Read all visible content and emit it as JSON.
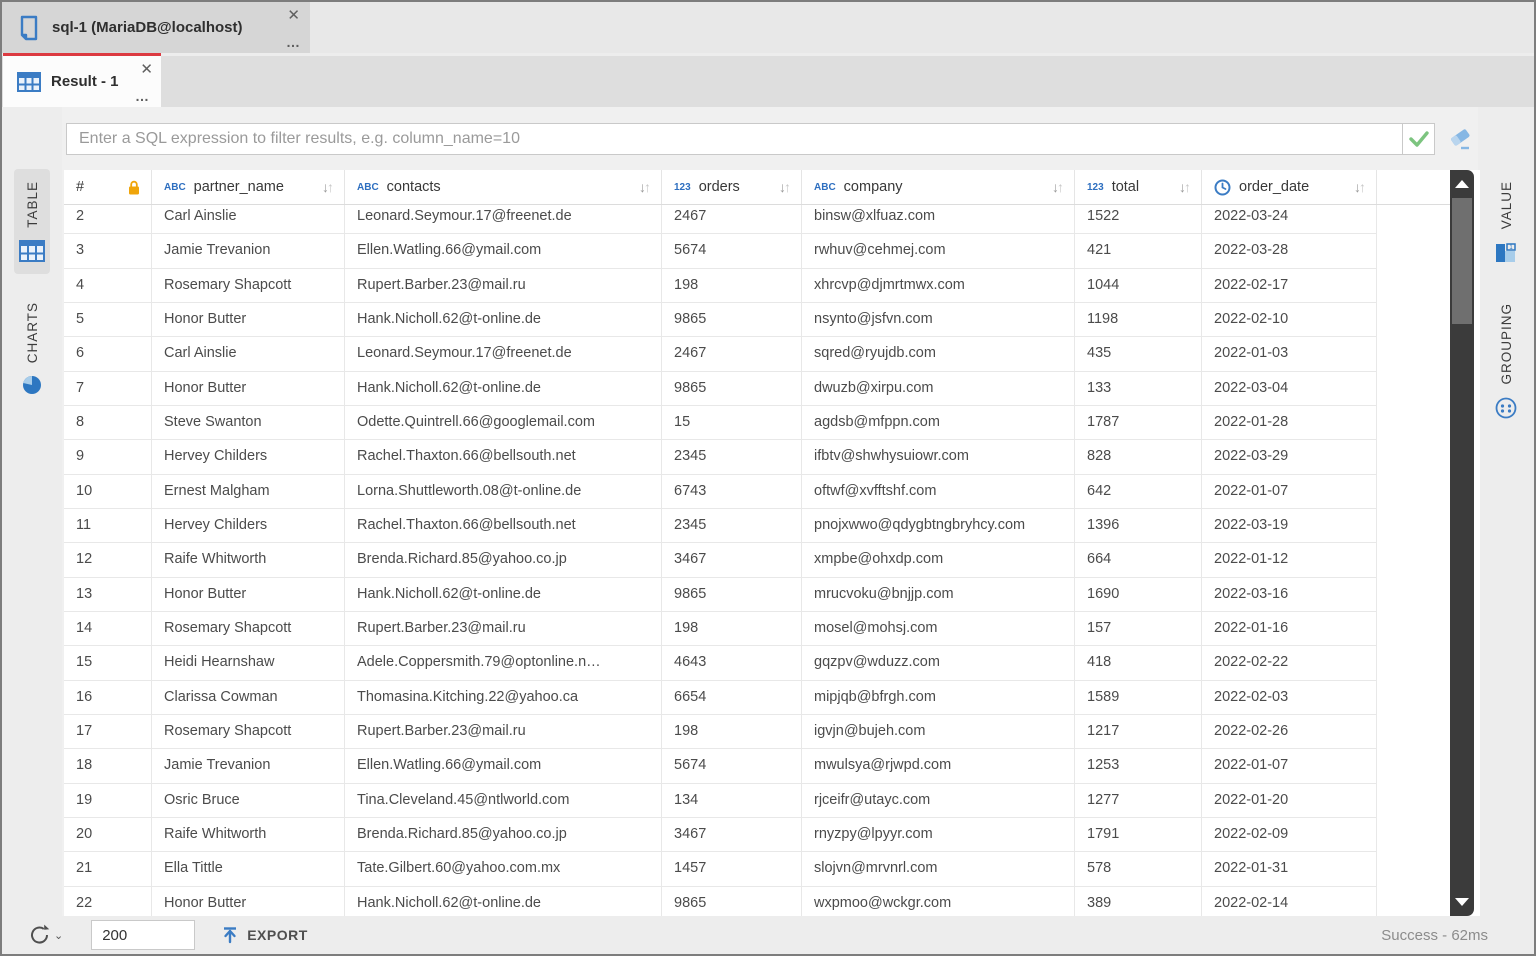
{
  "editor_tab": {
    "title": "sql-1 (MariaDB@localhost)",
    "close": "✕",
    "menu": "…"
  },
  "result_tab": {
    "title": "Result - 1",
    "close": "✕",
    "menu": "…"
  },
  "filter": {
    "placeholder": "Enter a SQL expression to filter results, e.g. column_name=10"
  },
  "left_rail": {
    "tabs": [
      {
        "label": "TABLE"
      },
      {
        "label": "CHARTS"
      }
    ]
  },
  "right_rail": {
    "tabs": [
      {
        "label": "VALUE"
      },
      {
        "label": "GROUPING"
      }
    ]
  },
  "table": {
    "row_number_header": "#",
    "columns": [
      {
        "label": "partner_name",
        "type_label": "ABC"
      },
      {
        "label": "contacts",
        "type_label": "ABC"
      },
      {
        "label": "orders",
        "type_label": "123"
      },
      {
        "label": "company",
        "type_label": "ABC"
      },
      {
        "label": "total",
        "type_label": "123"
      },
      {
        "label": "order_date",
        "type_label": ""
      }
    ],
    "rows": [
      [
        "2",
        "Carl Ainslie",
        "Leonard.Seymour.17@freenet.de",
        "2467",
        "binsw@xlfuaz.com",
        "1522",
        "2022-03-24"
      ],
      [
        "3",
        "Jamie Trevanion",
        "Ellen.Watling.66@ymail.com",
        "5674",
        "rwhuv@cehmej.com",
        "421",
        "2022-03-28"
      ],
      [
        "4",
        "Rosemary Shapcott",
        "Rupert.Barber.23@mail.ru",
        "198",
        "xhrcvp@djmrtmwx.com",
        "1044",
        "2022-02-17"
      ],
      [
        "5",
        "Honor Butter",
        "Hank.Nicholl.62@t-online.de",
        "9865",
        "nsynto@jsfvn.com",
        "1198",
        "2022-02-10"
      ],
      [
        "6",
        "Carl Ainslie",
        "Leonard.Seymour.17@freenet.de",
        "2467",
        "sqred@ryujdb.com",
        "435",
        "2022-01-03"
      ],
      [
        "7",
        "Honor Butter",
        "Hank.Nicholl.62@t-online.de",
        "9865",
        "dwuzb@xirpu.com",
        "133",
        "2022-03-04"
      ],
      [
        "8",
        "Steve Swanton",
        "Odette.Quintrell.66@googlemail.com",
        "15",
        "agdsb@mfppn.com",
        "1787",
        "2022-01-28"
      ],
      [
        "9",
        "Hervey Childers",
        "Rachel.Thaxton.66@bellsouth.net",
        "2345",
        "ifbtv@shwhysuiowr.com",
        "828",
        "2022-03-29"
      ],
      [
        "10",
        "Ernest Malgham",
        "Lorna.Shuttleworth.08@t-online.de",
        "6743",
        "oftwf@xvfftshf.com",
        "642",
        "2022-01-07"
      ],
      [
        "11",
        "Hervey Childers",
        "Rachel.Thaxton.66@bellsouth.net",
        "2345",
        "pnojxwwo@qdygbtngbryhcy.com",
        "1396",
        "2022-03-19"
      ],
      [
        "12",
        "Raife Whitworth",
        "Brenda.Richard.85@yahoo.co.jp",
        "3467",
        "xmpbe@ohxdp.com",
        "664",
        "2022-01-12"
      ],
      [
        "13",
        "Honor Butter",
        "Hank.Nicholl.62@t-online.de",
        "9865",
        "mrucvoku@bnjjp.com",
        "1690",
        "2022-03-16"
      ],
      [
        "14",
        "Rosemary Shapcott",
        "Rupert.Barber.23@mail.ru",
        "198",
        "mosel@mohsj.com",
        "157",
        "2022-01-16"
      ],
      [
        "15",
        "Heidi Hearnshaw",
        "Adele.Coppersmith.79@optonline.n…",
        "4643",
        "gqzpv@wduzz.com",
        "418",
        "2022-02-22"
      ],
      [
        "16",
        "Clarissa Cowman",
        "Thomasina.Kitching.22@yahoo.ca",
        "6654",
        "mipjqb@bfrgh.com",
        "1589",
        "2022-02-03"
      ],
      [
        "17",
        "Rosemary Shapcott",
        "Rupert.Barber.23@mail.ru",
        "198",
        "igvjn@bujeh.com",
        "1217",
        "2022-02-26"
      ],
      [
        "18",
        "Jamie Trevanion",
        "Ellen.Watling.66@ymail.com",
        "5674",
        "mwulsya@rjwpd.com",
        "1253",
        "2022-01-07"
      ],
      [
        "19",
        "Osric Bruce",
        "Tina.Cleveland.45@ntlworld.com",
        "134",
        "rjceifr@utayc.com",
        "1277",
        "2022-01-20"
      ],
      [
        "20",
        "Raife Whitworth",
        "Brenda.Richard.85@yahoo.co.jp",
        "3467",
        "rnyzpy@lpyyr.com",
        "1791",
        "2022-02-09"
      ],
      [
        "21",
        "Ella Tittle",
        "Tate.Gilbert.60@yahoo.com.mx",
        "1457",
        "slojvn@mrvnrl.com",
        "578",
        "2022-01-31"
      ],
      [
        "22",
        "Honor Butter",
        "Hank.Nicholl.62@t-online.de",
        "9865",
        "wxpmoo@wckgr.com",
        "389",
        "2022-02-14"
      ]
    ]
  },
  "bottom_bar": {
    "fetch_size": "200",
    "export_label": "EXPORT",
    "status": "Success - 62ms"
  },
  "colors": {
    "accent_blue": "#3b7cc4",
    "type_blue": "#2e6fc0",
    "lock_orange": "#f0a50a",
    "tab_indicator_red": "#dc3a41",
    "check_green": "#7cc47f",
    "eraser_blue": "#86b7e4"
  }
}
